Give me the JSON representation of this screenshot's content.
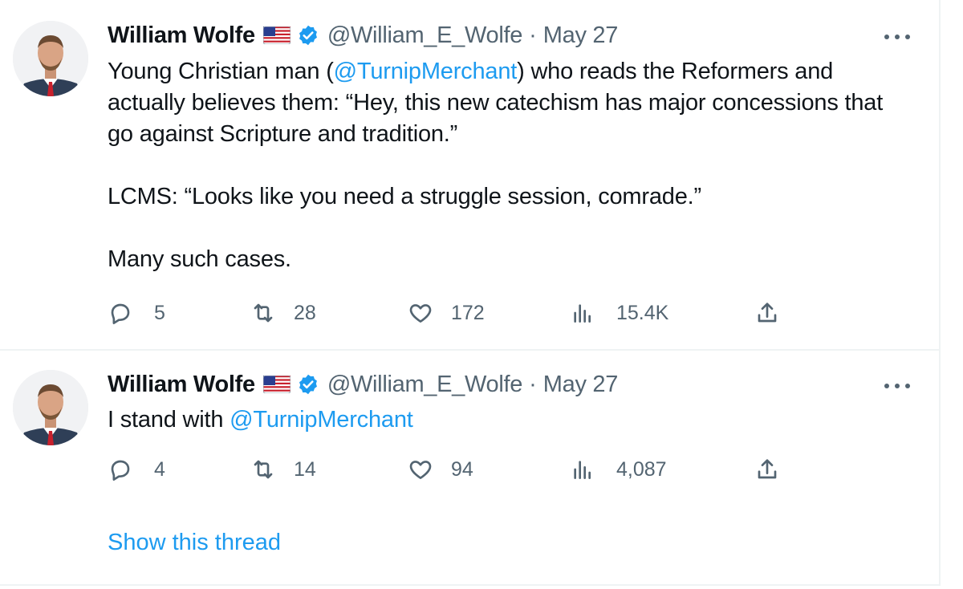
{
  "colors": {
    "accent": "#1d9bf0",
    "text": "#0f1419",
    "secondary": "#536471",
    "border": "#eff3f4"
  },
  "tweets": [
    {
      "author": {
        "name": "William Wolfe",
        "handle": "@William_E_Wolfe",
        "flag_icon": "us-flag-icon",
        "verified_icon": "verified-badge-icon"
      },
      "separator": "·",
      "date": "May 27",
      "text": {
        "p1_a": "Young Christian man (",
        "p1_mention": "@TurnipMerchant",
        "p1_b": ") who reads the Reformers and actually believes them: “Hey, this new catechism has major concessions that go against Scripture and tradition.”",
        "p2": "LCMS: “Looks like you need a struggle session, comrade.”",
        "p3": "Many such cases."
      },
      "stats": {
        "replies": "5",
        "retweets": "28",
        "likes": "172",
        "views": "15.4K"
      }
    },
    {
      "author": {
        "name": "William Wolfe",
        "handle": "@William_E_Wolfe",
        "flag_icon": "us-flag-icon",
        "verified_icon": "verified-badge-icon"
      },
      "separator": "·",
      "date": "May 27",
      "text": {
        "p1_a": "I stand with ",
        "p1_mention": "@TurnipMerchant"
      },
      "stats": {
        "replies": "4",
        "retweets": "14",
        "likes": "94",
        "views": "4,087"
      }
    }
  ],
  "show_thread": "Show this thread"
}
